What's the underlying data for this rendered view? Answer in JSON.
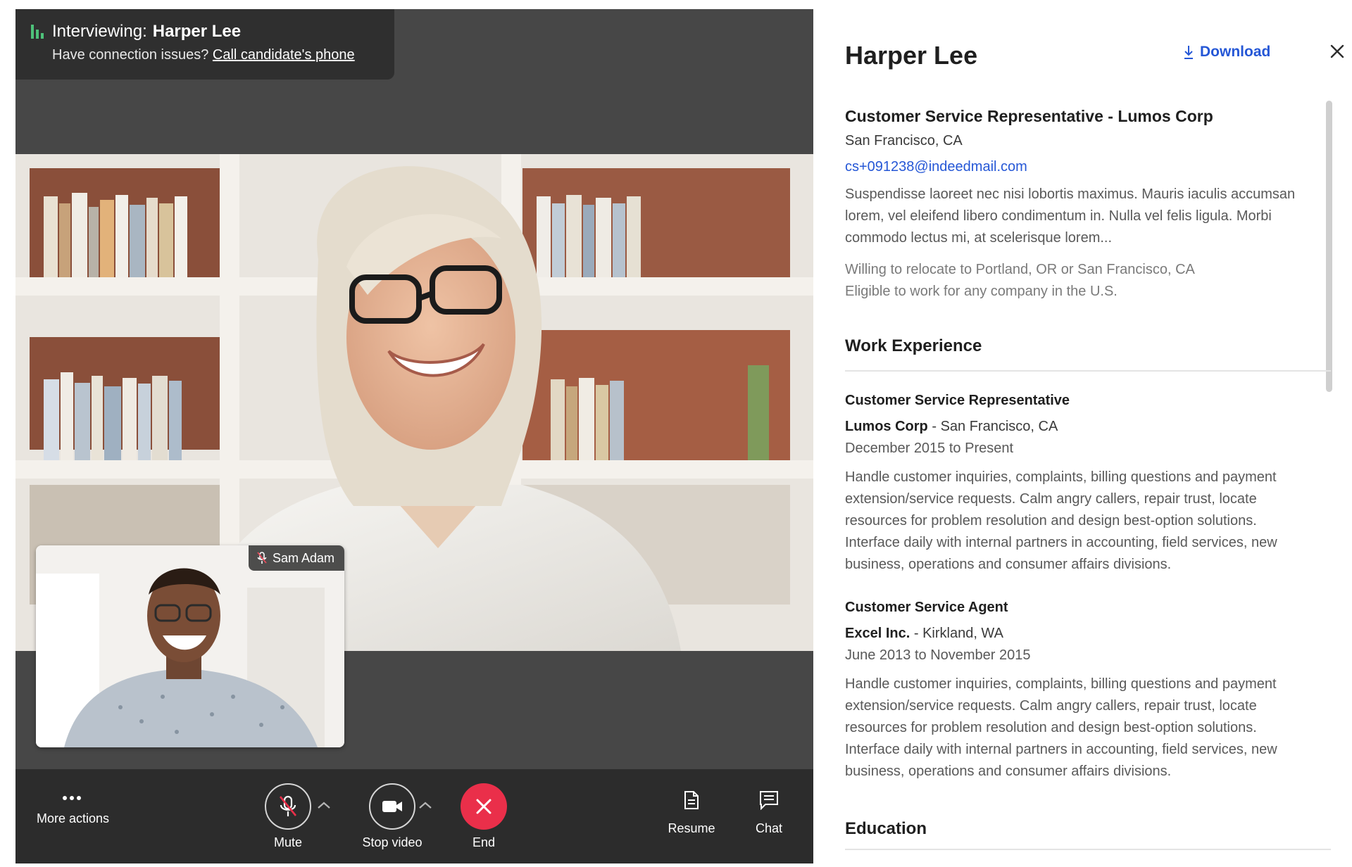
{
  "call": {
    "interviewing_prefix": "Interviewing:",
    "candidate_name": "Harper Lee",
    "connection_text": "Have connection issues?",
    "call_phone_link": "Call candidate's phone",
    "self_view_name": "Sam Adam",
    "status_color": "#4ec27a",
    "end_color": "#ea2f4a"
  },
  "controls": {
    "more_actions": "More actions",
    "mute": "Mute",
    "stop_video": "Stop video",
    "end": "End",
    "resume": "Resume",
    "chat": "Chat"
  },
  "resume": {
    "name": "Harper Lee",
    "download": "Download",
    "headline": "Customer Service Representative - Lumos Corp",
    "location": "San Francisco, CA",
    "email": "cs+091238@indeedmail.com",
    "summary": "Suspendisse laoreet nec nisi lobortis maximus. Mauris iaculis accumsan lorem, vel eleifend libero condimentum in. Nulla vel felis ligula. Morbi commodo lectus mi, at scelerisque lorem...",
    "relocate": "Willing to relocate to Portland, OR or San Francisco, CA",
    "eligibility": "Eligible to work for any company in the U.S.",
    "work_experience_heading": "Work Experience",
    "education_heading": "Education",
    "experience": [
      {
        "title": "Customer Service Representative",
        "company": "Lumos Corp",
        "location": "San Francisco, CA",
        "dates": "December 2015 to Present",
        "description": "Handle customer inquiries, complaints, billing questions and payment extension/service requests. Calm angry callers, repair trust, locate resources for problem resolution and design best-option solutions. Interface daily with internal partners in accounting, field services, new business, operations and consumer affairs divisions."
      },
      {
        "title": "Customer Service Agent",
        "company": "Excel Inc.",
        "location": "Kirkland, WA",
        "dates": "June 2013 to November 2015",
        "description": "Handle customer inquiries, complaints, billing questions and payment extension/service requests. Calm angry callers, repair trust, locate resources for problem resolution and design best-option solutions. Interface daily with internal partners in accounting, field services, new business, operations and consumer affairs divisions."
      }
    ],
    "link_color": "#2557d6"
  }
}
